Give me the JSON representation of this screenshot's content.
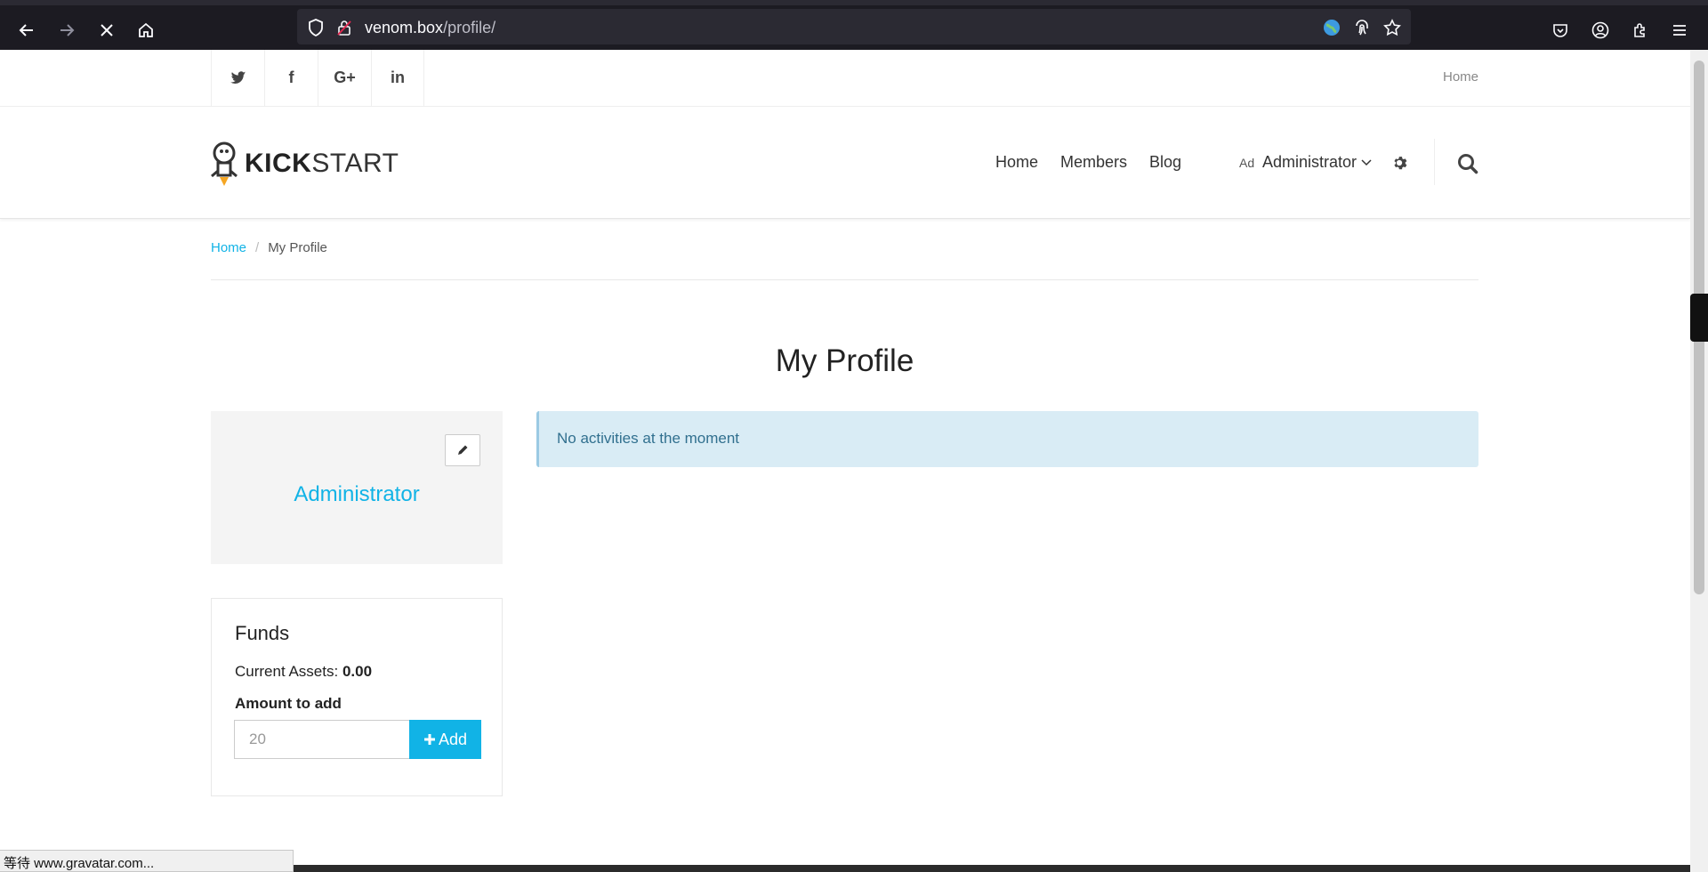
{
  "browser": {
    "url_domain": "venom.box",
    "url_path": "/profile/",
    "status_text": "等待 www.gravatar.com..."
  },
  "topbar": {
    "social": [
      {
        "icon": "twitter-icon",
        "glyph": "🐦"
      },
      {
        "icon": "facebook-icon",
        "glyph": "f"
      },
      {
        "icon": "google-plus-icon",
        "glyph": "G+"
      },
      {
        "icon": "linkedin-icon",
        "glyph": "in"
      }
    ],
    "home_link": "Home"
  },
  "header": {
    "logo_bold": "KICK",
    "logo_light": "START",
    "nav": [
      "Home",
      "Members",
      "Blog"
    ],
    "avatar_alt": "Ad",
    "user_label": "Administrator"
  },
  "breadcrumb": {
    "home": "Home",
    "separator": "/",
    "current": "My Profile"
  },
  "page": {
    "title": "My Profile"
  },
  "profile": {
    "name": "Administrator"
  },
  "activity": {
    "message": "No activities at the moment"
  },
  "funds": {
    "title": "Funds",
    "assets_label": "Current Assets:",
    "assets_value": "0.00",
    "amount_label": "Amount to add",
    "amount_value": "20",
    "add_label": "Add"
  },
  "colors": {
    "accent": "#11b3e6",
    "alert_bg": "#d9ecf5",
    "alert_text": "#31708f"
  }
}
